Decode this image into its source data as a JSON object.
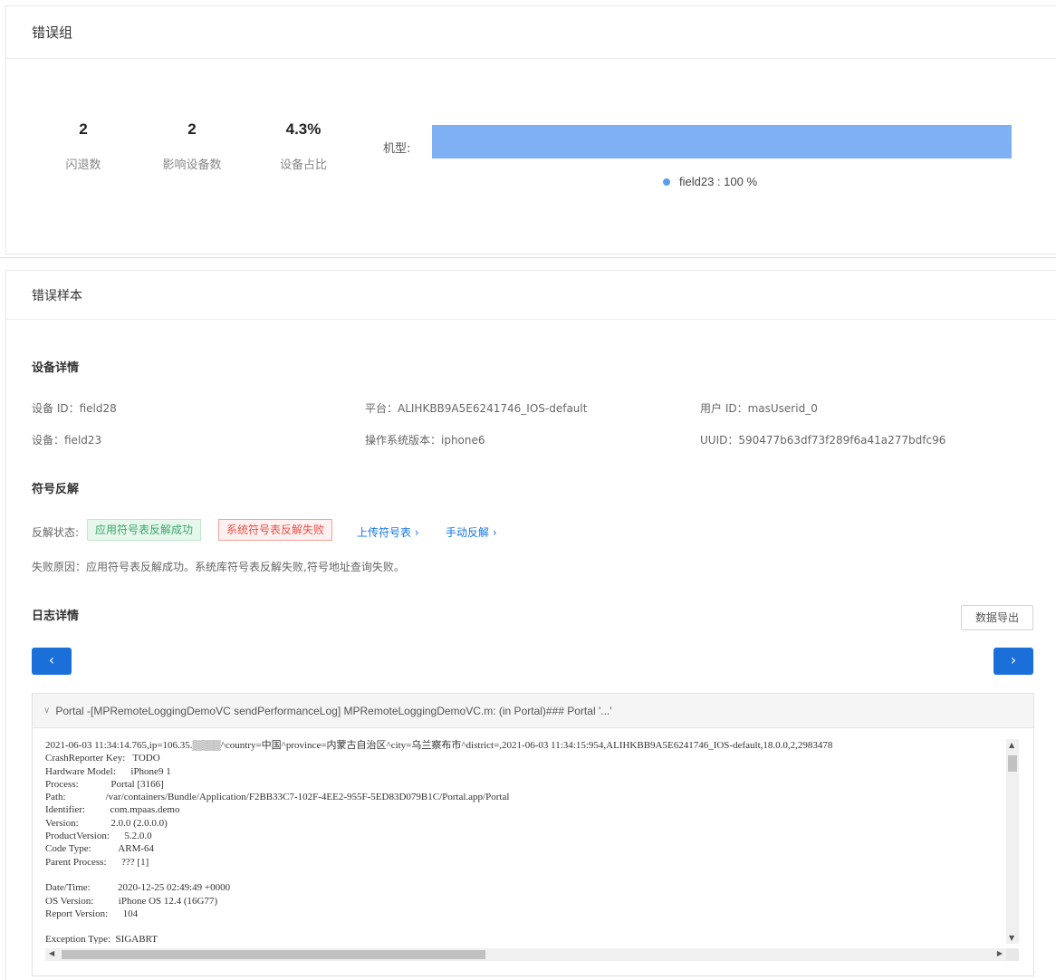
{
  "error_group": {
    "title": "错误组",
    "stats": [
      {
        "value": "2",
        "label": "闪退数"
      },
      {
        "value": "2",
        "label": "影响设备数"
      },
      {
        "value": "4.3%",
        "label": "设备占比"
      }
    ],
    "model_label": "机型:",
    "model_distribution": {
      "name": "field23",
      "percent": 100,
      "legend_text": "field23 : 100 %",
      "color": "#7fb0f3"
    }
  },
  "error_sample": {
    "title": "错误样本",
    "device_section": {
      "title": "设备详情",
      "items": [
        "设备 ID：field28",
        "平台：ALIHKBB9A5E6241746_IOS-default",
        "用户 ID：masUserid_0",
        "设备：field23",
        "操作系统版本：iphone6",
        "UUID：590477b63df73f289f6a41a277bdfc96"
      ]
    },
    "symbol_section": {
      "title": "符号反解",
      "status_label": "反解状态:",
      "badge_success": "应用符号表反解成功",
      "badge_fail": "系统符号表反解失败",
      "link_upload": "上传符号表",
      "link_manual": "手动反解",
      "failure_reason": "失败原因：应用符号表反解成功。系统库符号表反解失败,符号地址查询失败。"
    },
    "log_section": {
      "title": "日志详情",
      "export_button": "数据导出",
      "prev_button": "‹",
      "next_button": "›",
      "log_header": "Portal -[MPRemoteLoggingDemoVC sendPerformanceLog] MPRemoteLoggingDemoVC.m: (in Portal)### Portal '...'",
      "log_lines": [
        "2021-06-03 11:34:14.765,ip=106.35.▒▒▒▒^country=中国^province=内蒙古自治区^city=乌兰察布市^district=,2021-06-03 11:34:15:954,ALIHKBB9A5E6241746_IOS-default,18.0.0,2,2983478",
        "CrashReporter Key:   TODO",
        "Hardware Model:      iPhone9 1",
        "Process:             Portal [3166]",
        "Path:                /var/containers/Bundle/Application/F2BB33C7-102F-4EE2-955F-5ED83D079B1C/Portal.app/Portal",
        "Identifier:          com.mpaas.demo",
        "Version:             2.0.0 (2.0.0.0)",
        "ProductVersion:      5.2.0.0",
        "Code Type:           ARM-64",
        "Parent Process:      ??? [1]",
        "",
        "Date/Time:           2020-12-25 02:49:49 +0000",
        "OS Version:          iPhone OS 12.4 (16G77)",
        "Report Version:      104",
        "",
        "Exception Type:  SIGABRT"
      ]
    }
  }
}
